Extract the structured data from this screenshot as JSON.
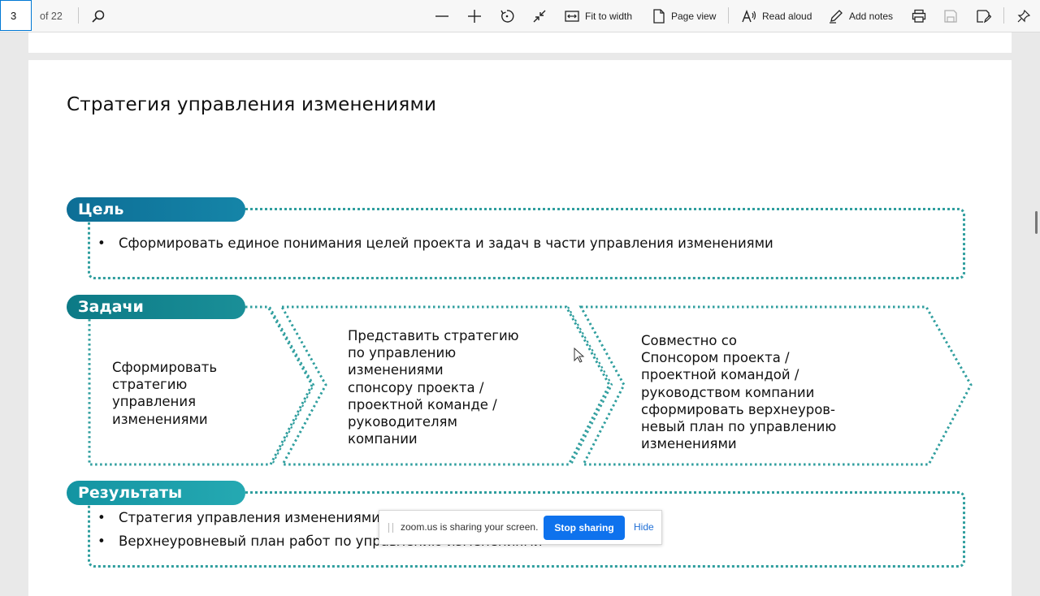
{
  "toolbar": {
    "page_number": "3",
    "page_of": "of 22",
    "fit_to_width": "Fit to width",
    "page_view": "Page view",
    "read_aloud": "Read aloud",
    "add_notes": "Add notes"
  },
  "slide": {
    "title": "Стратегия управления изменениями",
    "goal": {
      "label": "Цель",
      "bullet": "Сформировать единое понимания целей проекта и задач в части управления изменениями"
    },
    "tasks": {
      "label": "Задачи",
      "steps": [
        {
          "lines": [
            "Сформировать",
            "стратегию",
            "управления",
            "изменениями"
          ]
        },
        {
          "lines": [
            "Представить стратегию",
            "по управлению",
            "изменениями",
            "спонсору проекта /",
            "проектной команде /",
            "руководителям",
            "компании"
          ]
        },
        {
          "lines": [
            "Совместно со",
            "Спонсором проекта /",
            "проектной командой /",
            "руководством компании",
            "сформировать верхнеуров-",
            "невый план по управлению",
            "изменениями"
          ]
        }
      ]
    },
    "results": {
      "label": "Результаты",
      "bullets": [
        "Стратегия управления изменениями",
        "Верхнеуровневый план работ по управлению изменениями"
      ]
    }
  },
  "zoom": {
    "message": "zoom.us is sharing your screen.",
    "stop_label": "Stop sharing",
    "hide_label": "Hide"
  },
  "colors": {
    "accent": "#0078d4",
    "dotted_border": "#2f9e9e",
    "zoom_button": "#0e72ed"
  }
}
